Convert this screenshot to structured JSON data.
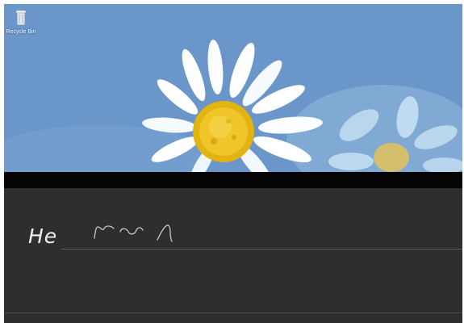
{
  "desktop": {
    "icons": [
      {
        "label": "Recycle Bin",
        "icon": "recycle-bin-icon"
      }
    ],
    "wallpaper": "daisy-flower-wallpaper"
  },
  "handwriting_panel": {
    "recognized_text": "He",
    "ink": "handwritten-ink-strokes"
  },
  "colors": {
    "sky": "#6f98cb",
    "panel": "#2d2e30",
    "strip": "#050505",
    "petal": "#ffffff",
    "flower_center": "#e7b812"
  }
}
